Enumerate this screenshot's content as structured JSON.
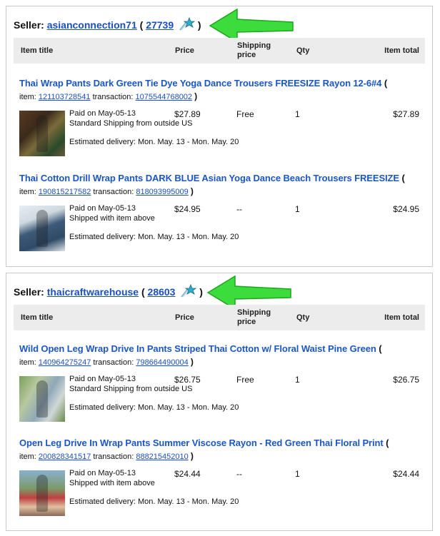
{
  "colors": {
    "link": "#1a4fbf",
    "header_bg": "#ececec",
    "arrow": "#2ecc2e",
    "star": "#2ab0c8"
  },
  "columns": {
    "title": "Item title",
    "price": "Price",
    "shipping_1": "Shipping",
    "shipping_2": "price",
    "qty": "Qty",
    "total": "Item total"
  },
  "sellers": [
    {
      "label": "Seller:",
      "name": "asianconnection71",
      "feedback": "27739",
      "star_icon": "turquoise-shooting-star-icon",
      "items": [
        {
          "title": "Thai Wrap Pants Dark Green Tie Dye Yoga Dance Trousers FREESIZE Rayon 12-6#4",
          "item_label": "item:",
          "item_no": "121103728541",
          "transaction_label": "transaction:",
          "transaction_no": "1075544768002",
          "paid": "Paid on May-05-13",
          "shipping_note": "Standard Shipping from outside US",
          "estimated": "Estimated delivery: Mon. May. 13 - Mon. May. 20",
          "price": "$27.89",
          "shipping": "Free",
          "qty": "1",
          "total": "$27.89"
        },
        {
          "title": "Thai Cotton Drill Wrap Pants DARK BLUE Asian Yoga Dance Beach Trousers FREESIZE",
          "item_label": "item:",
          "item_no": "190815217582",
          "transaction_label": "transaction:",
          "transaction_no": "818093995009",
          "paid": "Paid on May-05-13",
          "shipping_note": "Shipped with item above",
          "estimated": "Estimated delivery: Mon. May. 13 - Mon. May. 20",
          "price": "$24.95",
          "shipping": "--",
          "qty": "1",
          "total": "$24.95"
        }
      ]
    },
    {
      "label": "Seller:",
      "name": "thaicraftwarehouse",
      "feedback": "28603",
      "star_icon": "turquoise-shooting-star-icon",
      "items": [
        {
          "title": "Wild Open Leg Wrap Drive In Pants Striped Thai Cotton w/ Floral Waist Pine Green",
          "item_label": "item:",
          "item_no": "140964275247",
          "transaction_label": "transaction:",
          "transaction_no": "798664490004",
          "paid": "Paid on May-05-13",
          "shipping_note": "Standard Shipping from outside US",
          "estimated": "Estimated delivery: Mon. May. 13 - Mon. May. 20",
          "price": "$26.75",
          "shipping": "Free",
          "qty": "1",
          "total": "$26.75"
        },
        {
          "title": "Open Leg Drive In Wrap Pants Summer Viscose Rayon - Red Green Thai Floral Print",
          "item_label": "item:",
          "item_no": "200828341517",
          "transaction_label": "transaction:",
          "transaction_no": "888215452010",
          "paid": "Paid on May-05-13",
          "shipping_note": "Shipped with item above",
          "estimated": "Estimated delivery: Mon. May. 13 - Mon. May. 20",
          "price": "$24.44",
          "shipping": "--",
          "qty": "1",
          "total": "$24.44"
        }
      ]
    }
  ]
}
